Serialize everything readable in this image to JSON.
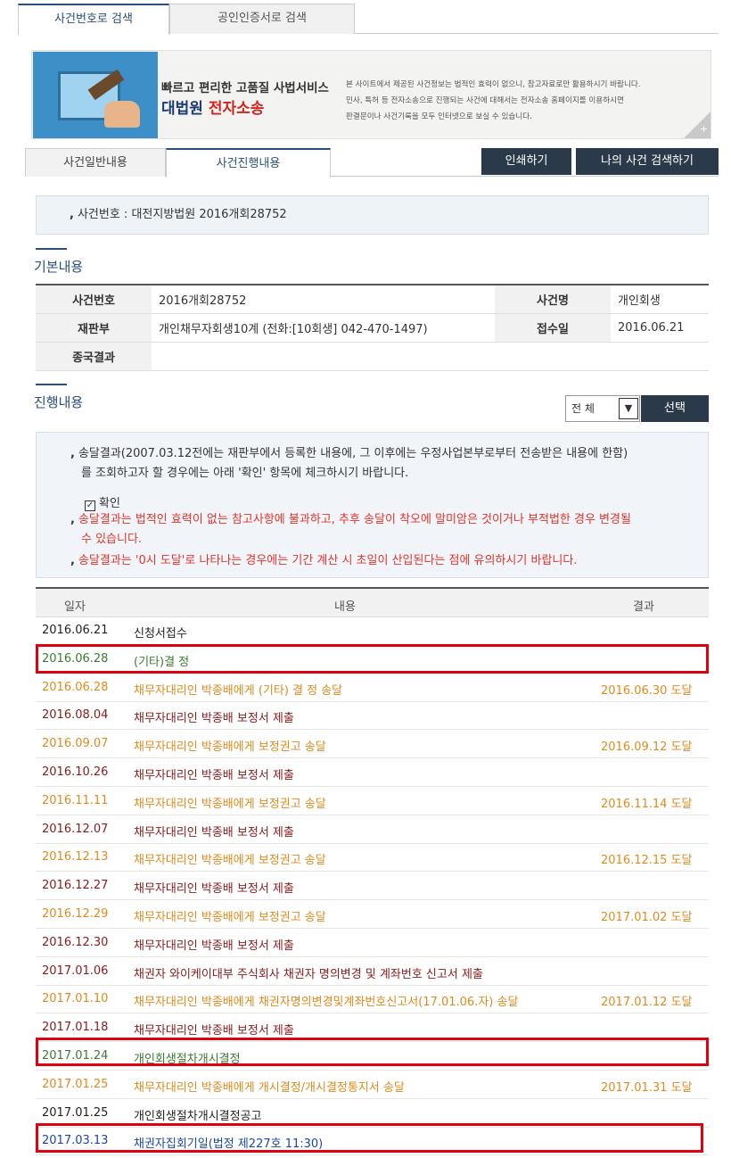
{
  "top_tabs": {
    "search_by_case": "사건번호로 검색",
    "search_by_cert": "공인인증서로 검색"
  },
  "banner": {
    "slogan": "빠르고 편리한 고품질 사법서비스",
    "brand_court": "대법원",
    "brand_ecase": "전자소송",
    "notice_lines": [
      "본 사이트에서 제공된 사건정보는 법적인 효력이 없으니, 참고자료로만 활용하시기 바랍니다.",
      "민사, 특허 등 전자소송으로 진행되는 사건에 대해서는 전자소송 홈페이지를 이용하시면",
      "판결문이나 사건기록을 모두 인터넷으로 보실 수 있습니다."
    ],
    "plus": "+"
  },
  "sub_tabs": {
    "general": "사건일반내용",
    "progress": "사건진행내용"
  },
  "buttons": {
    "print": "인쇄하기",
    "my_case": "나의 사건 검색하기",
    "select": "선택"
  },
  "case_line": "사건번호 : 대전지방법원 2016개회28752",
  "basic": {
    "title": "기본내용",
    "case_no_label": "사건번호",
    "case_no": "2016개회28752",
    "case_name_label": "사건명",
    "case_name": "개인회생",
    "court_label": "재판부",
    "court": "개인채무자회생10계 (전화:[10회생] 042-470-1497)",
    "received_label": "접수일",
    "received": "2016.06.21",
    "final_label": "종국결과",
    "final": ""
  },
  "progress": {
    "title": "진행내용",
    "filter_value": "전 체",
    "notice1a": "송달결과(2007.03.12전에는 재판부에서 등록한 내용에, 그 이후에는 우정사업본부로부터 전송받은 내용에 한함)",
    "notice1b": "를 조회하고자 할 경우에는 아래 '확인' 항목에 체크하시기 바랍니다.",
    "confirm_label": "확인",
    "notice2a": "송달결과는 법적인 효력이 없는 참고사항에 불과하고, 추후 송달이 착오에 말미암은 것이거나 부적법한 경우 변경될",
    "notice2b": "수 있습니다.",
    "notice3": "송달결과는 '0시 도달'로 나타나는 경우에는 기간 계산 시 초일이 산입된다는 점에 유의하시기 바랍니다.",
    "headers": {
      "date": "일자",
      "content": "내용",
      "result": "결과"
    },
    "rows": [
      {
        "date": "2016.06.21",
        "content": "신청서접수",
        "result": ""
      },
      {
        "date": "2016.06.28",
        "content": "(기타)결 정",
        "result": ""
      },
      {
        "date": "2016.06.28",
        "content": "채무자대리인 박종배에게 (기타) 결 정 송달",
        "result": "2016.06.30 도달"
      },
      {
        "date": "2016.08.04",
        "content": "채무자대리인 박종배 보정서 제출",
        "result": ""
      },
      {
        "date": "2016.09.07",
        "content": "채무자대리인 박종배에게 보정권고 송달",
        "result": "2016.09.12 도달"
      },
      {
        "date": "2016.10.26",
        "content": "채무자대리인 박종배 보정서 제출",
        "result": ""
      },
      {
        "date": "2016.11.11",
        "content": "채무자대리인 박종배에게 보정권고 송달",
        "result": "2016.11.14 도달"
      },
      {
        "date": "2016.12.07",
        "content": "채무자대리인 박종배 보정서 제출",
        "result": ""
      },
      {
        "date": "2016.12.13",
        "content": "채무자대리인 박종배에게 보정권고 송달",
        "result": "2016.12.15 도달"
      },
      {
        "date": "2016.12.27",
        "content": "채무자대리인 박종배 보정서 제출",
        "result": ""
      },
      {
        "date": "2016.12.29",
        "content": "채무자대리인 박종배에게 보정권고 송달",
        "result": "2017.01.02 도달"
      },
      {
        "date": "2016.12.30",
        "content": "채무자대리인 박종배 보정서 제출",
        "result": ""
      },
      {
        "date": "2017.01.06",
        "content": "채권자 와이케이대부 주식회사 채권자 명의변경 및 계좌번호 신고서 제출",
        "result": ""
      },
      {
        "date": "2017.01.10",
        "content": "채무자대리인 박종배에게 채권자명의변경및계좌번호신고서(17.01.06.자) 송달",
        "result": "2017.01.12 도달"
      },
      {
        "date": "2017.01.18",
        "content": "채무자대리인 박종배 보정서 제출",
        "result": ""
      },
      {
        "date": "2017.01.24",
        "content": "개인회생절차개시결정",
        "result": ""
      },
      {
        "date": "2017.01.25",
        "content": "채무자대리인 박종배에게 개시결정/개시결정통지서 송달",
        "result": "2017.01.31 도달"
      },
      {
        "date": "2017.01.25",
        "content": "개인회생절차개시결정공고",
        "result": ""
      },
      {
        "date": "2017.03.13",
        "content": "채권자집회기일(법정 제227호 11:30)",
        "result": ""
      }
    ]
  }
}
